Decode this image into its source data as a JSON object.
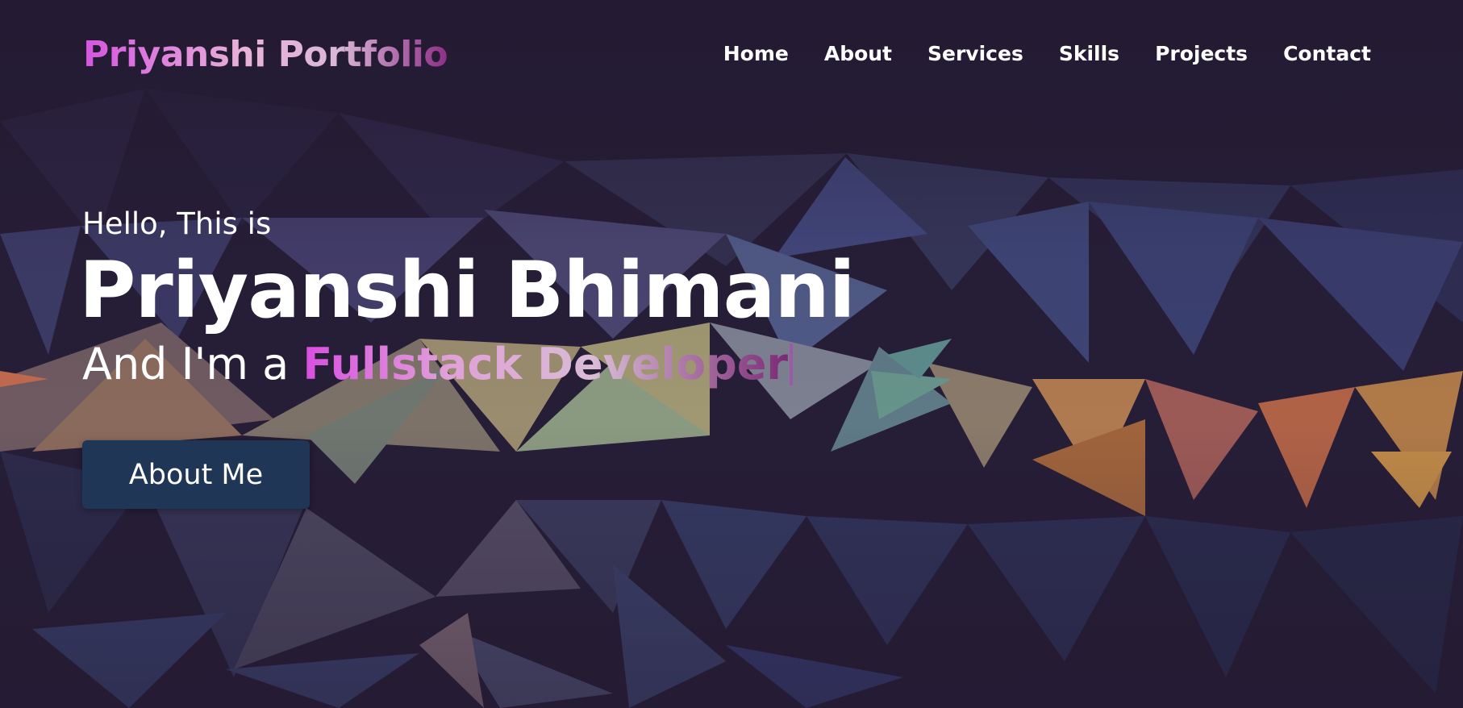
{
  "navbar": {
    "logo": "Priyanshi Portfolio",
    "items": [
      {
        "label": "Home"
      },
      {
        "label": "About"
      },
      {
        "label": "Services"
      },
      {
        "label": "Skills"
      },
      {
        "label": "Projects"
      },
      {
        "label": "Contact"
      }
    ]
  },
  "hero": {
    "greeting": "Hello, This is",
    "name": "Priyanshi Bhimani",
    "role_prefix": "And I'm a ",
    "role_typed": "Fullstack Developer",
    "button_label": "About Me"
  },
  "colors": {
    "background": "#251c33",
    "accent_pink": "#d554e0",
    "button": "#1f3656",
    "text": "#ffffff"
  }
}
